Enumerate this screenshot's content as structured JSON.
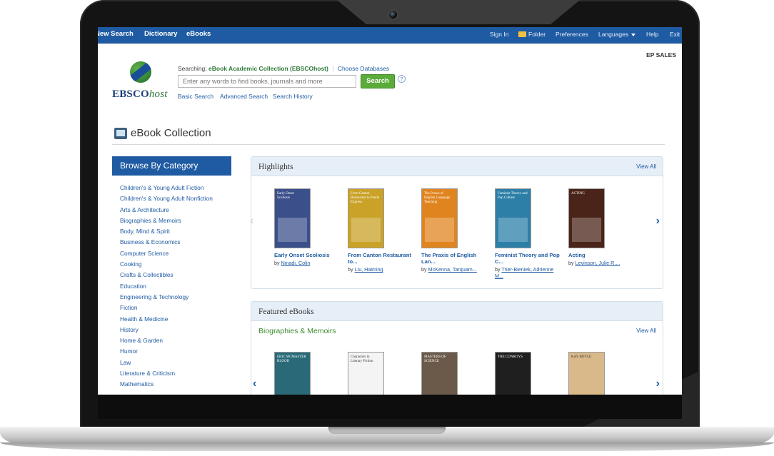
{
  "topbar": {
    "left_links": [
      "New Search",
      "Dictionary",
      "eBooks"
    ],
    "sign_in": "Sign In",
    "folder": "Folder",
    "preferences": "Preferences",
    "languages": "Languages",
    "help": "Help",
    "exit": "Exit"
  },
  "account_label": "EP SALES",
  "logo": {
    "brand": "EBSCO",
    "suffix": "host"
  },
  "search": {
    "searching_label": "Searching:",
    "database": "eBook Academic Collection (EBSCOhost)",
    "separator": "|",
    "choose_databases": "Choose Databases",
    "placeholder": "Enter any words to find books, journals and more",
    "button": "Search",
    "help_glyph": "?",
    "links": [
      "Basic Search",
      "Advanced Search",
      "Search History"
    ]
  },
  "collection_title": "eBook Collection",
  "browse": {
    "heading": "Browse By Category",
    "categories": [
      "Children's & Young Adult Fiction",
      "Children's & Young Adult Nonfiction",
      "Arts & Architecture",
      "Biographies & Memoirs",
      "Body, Mind & Spirit",
      "Business & Economics",
      "Computer Science",
      "Cooking",
      "Crafts & Collectibles",
      "Education",
      "Engineering & Technology",
      "Fiction",
      "Health & Medicine",
      "History",
      "Home & Garden",
      "Humor",
      "Law",
      "Literature & Criticism",
      "Mathematics"
    ]
  },
  "highlights": {
    "title": "Highlights",
    "view_all": "View All",
    "books": [
      {
        "title": "Early Onset Scoliosis",
        "by": "by",
        "author": "Ninadi, Colin",
        "cover_color": "#3b4f8a",
        "cover_text": "Early Onset Scoliosis"
      },
      {
        "title": "From Canton Restaurant to...",
        "by": "by",
        "author": "Liu, Haiming",
        "cover_color": "#c9a227",
        "cover_text": "From Canton Restaurant to Panda Express"
      },
      {
        "title": "The Praxis of English Lan...",
        "by": "by",
        "author": "McKenna, Tarquam...",
        "cover_color": "#e0841f",
        "cover_text": "The Praxis of English Language Teaching"
      },
      {
        "title": "Feminist Theory and Pop C...",
        "by": "by",
        "author": "Trier-Bieniek, Adrienne M...",
        "cover_color": "#2d7fa8",
        "cover_text": "Feminist Theory and Pop Culture"
      },
      {
        "title": "Acting",
        "by": "by",
        "author": "Levinson, Julie R....",
        "cover_color": "#4a2418",
        "cover_text": "ACTING"
      }
    ]
  },
  "featured": {
    "title": "Featured eBooks",
    "category": "Biographies & Memoirs",
    "view_all": "View All",
    "covers": [
      {
        "text": "ERIC MCMASTER BLOOD",
        "color": "#2a6a78"
      },
      {
        "text": "Characters in Literary Fiction",
        "color": "#f4f4f4"
      },
      {
        "text": "MASTERS OF SCIENCE",
        "color": "#6b5a4a"
      },
      {
        "text": "THE CONROYS",
        "color": "#1f1f1f"
      },
      {
        "text": "KAY BOYLE",
        "color": "#d9b98a"
      }
    ]
  },
  "nav_glyphs": {
    "prev": "‹",
    "next": "›"
  }
}
